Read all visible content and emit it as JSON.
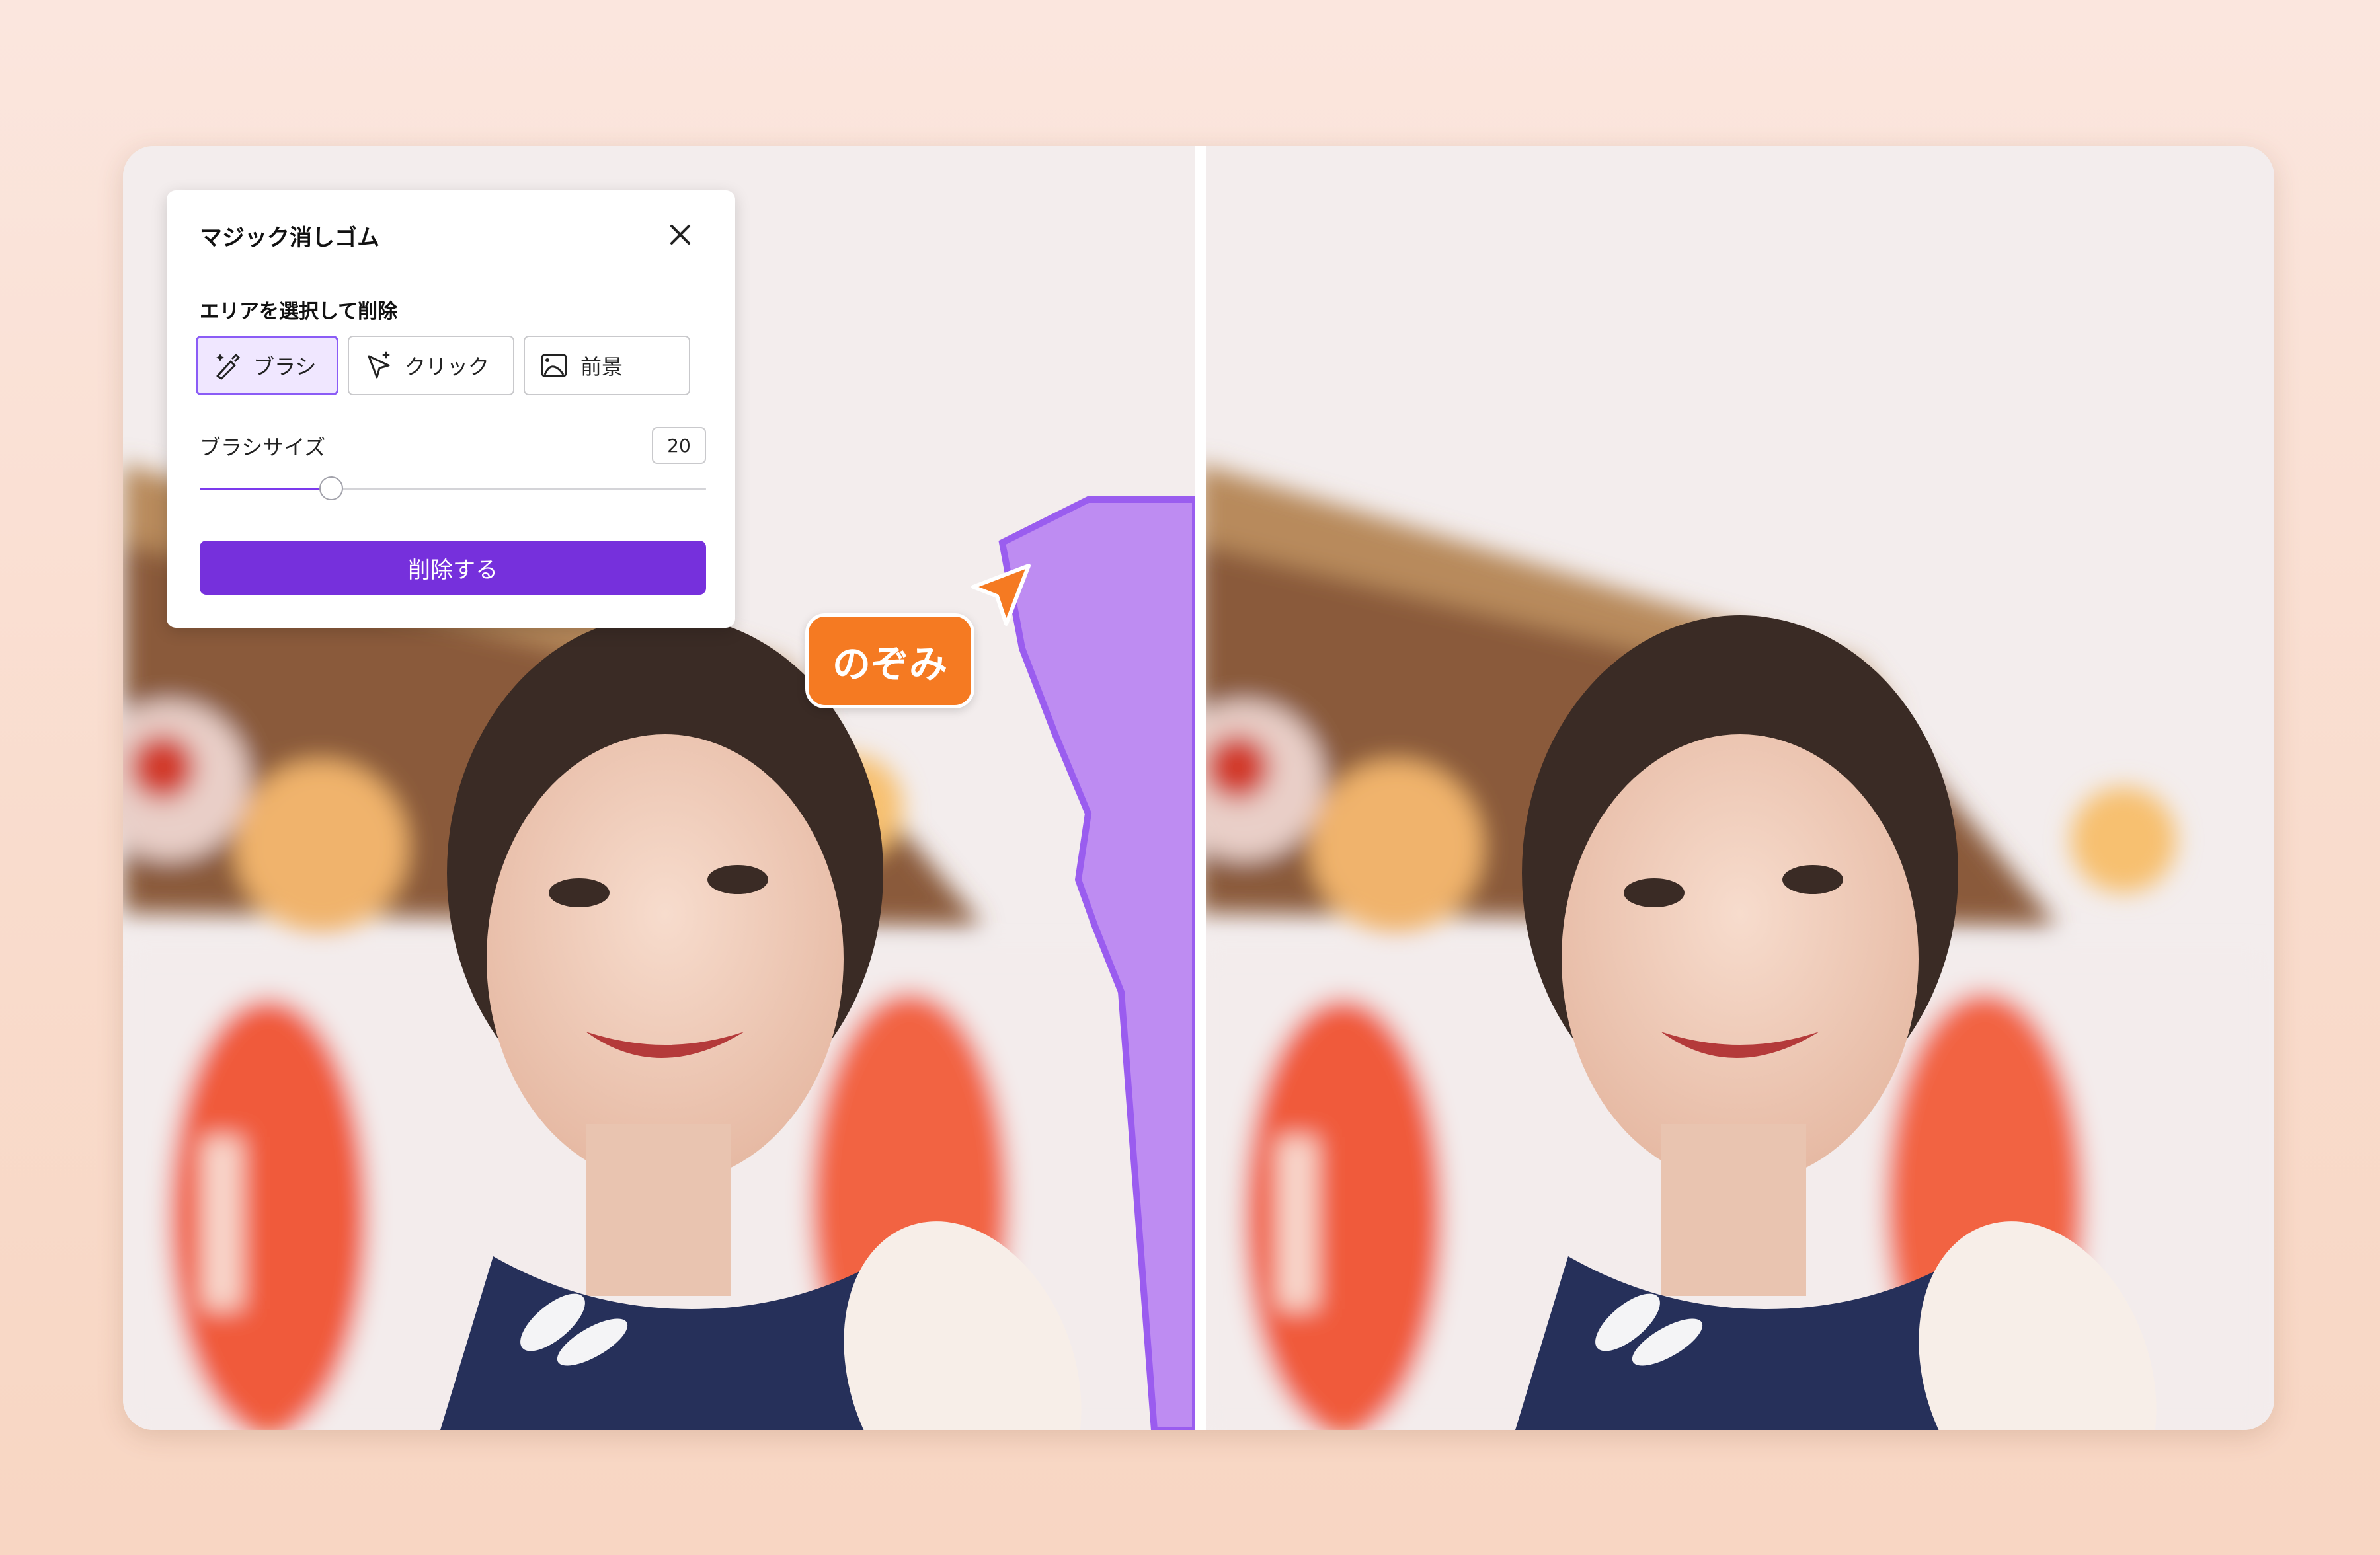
{
  "panel": {
    "title": "マジック消しゴム",
    "close_icon": "close-icon",
    "section_label": "エリアを選択して削除",
    "modes": [
      {
        "label": "ブラシ",
        "icon": "brush-icon",
        "active": true
      },
      {
        "label": "クリック",
        "icon": "click-sparkle-icon",
        "active": false
      },
      {
        "label": "前景",
        "icon": "foreground-image-icon",
        "active": false
      }
    ],
    "brush_size_label": "ブラシサイズ",
    "brush_size_value": "20",
    "brush_size_fraction": 0.26,
    "delete_button": "削除する"
  },
  "cursor": {
    "name": "のぞみ",
    "color": "#f57a22"
  },
  "colors": {
    "accent": "#7630dc",
    "selection": "#9b5cf0"
  }
}
